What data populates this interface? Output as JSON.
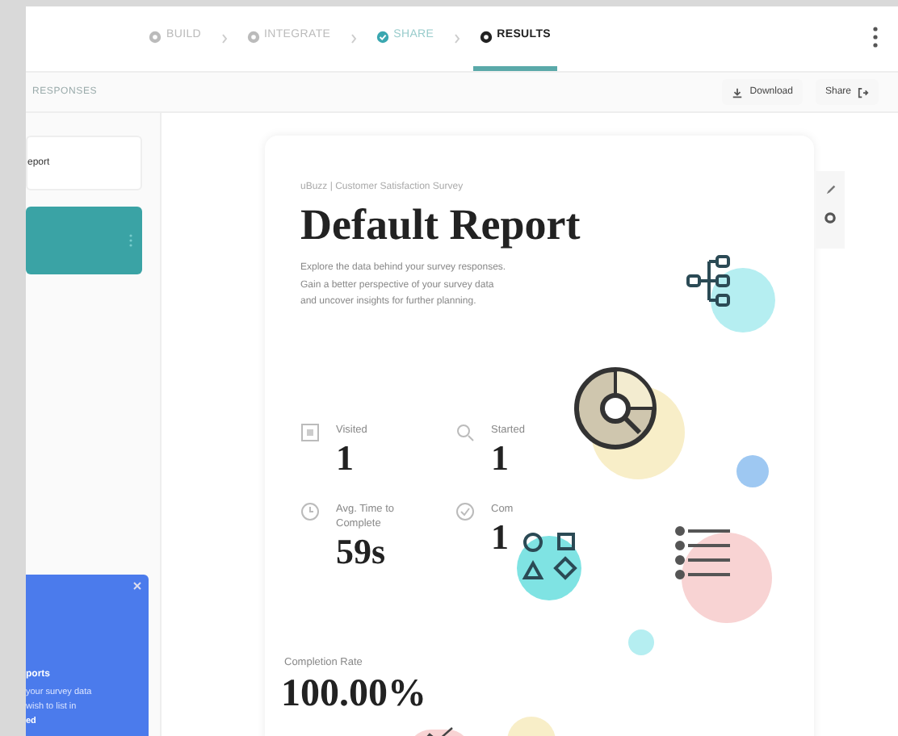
{
  "steps": [
    {
      "label": "BUILD",
      "kind": "done",
      "selected": false
    },
    {
      "label": "INTEGRATE",
      "kind": "done",
      "selected": false
    },
    {
      "label": "SHARE",
      "kind": "check",
      "selected": false
    },
    {
      "label": "RESULTS",
      "kind": "current",
      "selected": true
    }
  ],
  "toolbar": {
    "section": "RESPONSES",
    "buttons": [
      "Download",
      "Share"
    ]
  },
  "sidebar": {
    "items": [
      {
        "label": "eport",
        "selected": false
      },
      {
        "selected": true
      }
    ],
    "promo": {
      "title": "ports",
      "lines": [
        "your survey data",
        "wish to list in",
        "ed"
      ]
    }
  },
  "report": {
    "breadcrumb": "uBuzz | Customer Satisfaction Survey",
    "title": "Default Report",
    "description": "Explore the data behind your survey responses. Gain a better perspective of your survey data and uncover insights for further planning.",
    "stats": [
      {
        "kind": "visited",
        "label": "Visited",
        "value": "1"
      },
      {
        "kind": "started",
        "label": "Started",
        "value": "1"
      },
      {
        "kind": "time",
        "label": "Avg. Time to Complete",
        "value": "59s"
      },
      {
        "kind": "completed",
        "label": "Com",
        "value": "1"
      }
    ],
    "rate": {
      "label": "Completion Rate",
      "value": "100.00%"
    }
  }
}
